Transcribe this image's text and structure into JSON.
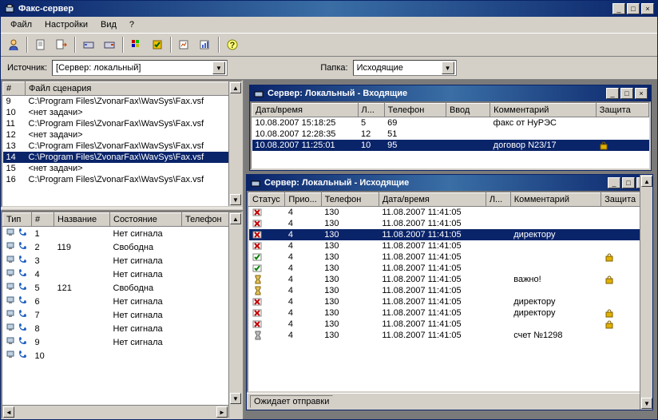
{
  "window": {
    "title": "Факс-сервер"
  },
  "menu": {
    "file": "Файл",
    "settings": "Настройки",
    "view": "Вид",
    "help": "?"
  },
  "filter": {
    "source_label": "Источник:",
    "source_value": "[Сервер: локальный]",
    "folder_label": "Папка:",
    "folder_value": "Исходящие"
  },
  "scenarios": {
    "cols": {
      "num": "#",
      "file": "Файл сценария"
    },
    "rows": [
      {
        "num": "9",
        "file": "C:\\Program Files\\ZvonarFax\\WavSys\\Fax.vsf"
      },
      {
        "num": "10",
        "file": "<нет задачи>"
      },
      {
        "num": "11",
        "file": "C:\\Program Files\\ZvonarFax\\WavSys\\Fax.vsf"
      },
      {
        "num": "12",
        "file": "<нет задачи>"
      },
      {
        "num": "13",
        "file": "C:\\Program Files\\ZvonarFax\\WavSys\\Fax.vsf"
      },
      {
        "num": "14",
        "file": "C:\\Program Files\\ZvonarFax\\WavSys\\Fax.vsf",
        "selected": true
      },
      {
        "num": "15",
        "file": "<нет задачи>"
      },
      {
        "num": "16",
        "file": "C:\\Program Files\\ZvonarFax\\WavSys\\Fax.vsf"
      }
    ]
  },
  "lines": {
    "cols": {
      "type": "Тип",
      "num": "#",
      "name": "Название",
      "state": "Состояние",
      "phone": "Телефон"
    },
    "rows": [
      {
        "num": "1",
        "name": "",
        "state": "Нет сигнала"
      },
      {
        "num": "2",
        "name": "119",
        "state": "Свободна"
      },
      {
        "num": "3",
        "name": "",
        "state": "Нет сигнала"
      },
      {
        "num": "4",
        "name": "",
        "state": "Нет сигнала"
      },
      {
        "num": "5",
        "name": "121",
        "state": "Свободна"
      },
      {
        "num": "6",
        "name": "",
        "state": "Нет сигнала"
      },
      {
        "num": "7",
        "name": "",
        "state": "Нет сигнала"
      },
      {
        "num": "8",
        "name": "",
        "state": "Нет сигнала"
      },
      {
        "num": "9",
        "name": "",
        "state": "Нет сигнала"
      },
      {
        "num": "10",
        "name": "",
        "state": ""
      }
    ]
  },
  "incoming": {
    "title": "Сервер: Локальный - Входящие",
    "cols": {
      "datetime": "Дата/время",
      "l": "Л...",
      "phone": "Телефон",
      "input": "Ввод",
      "comment": "Комментарий",
      "protect": "Защита"
    },
    "rows": [
      {
        "datetime": "10.08.2007 15:18:25",
        "l": "5",
        "phone": "69",
        "input": "",
        "comment": "факс от НуРЭС",
        "protect": ""
      },
      {
        "datetime": "10.08.2007 12:28:35",
        "l": "12",
        "phone": "51",
        "input": "",
        "comment": "",
        "protect": ""
      },
      {
        "datetime": "10.08.2007 11:25:01",
        "l": "10",
        "phone": "95",
        "input": "",
        "comment": "договор N23/17",
        "protect": "lock",
        "selected": true
      }
    ]
  },
  "outgoing": {
    "title": "Сервер: Локальный - Исходящие",
    "cols": {
      "status": "Статус",
      "prio": "Прио...",
      "phone": "Телефон",
      "datetime": "Дата/время",
      "l": "Л...",
      "comment": "Комментарий",
      "protect": "Защита"
    },
    "status_text": "Ожидает отправки",
    "rows": [
      {
        "icon": "fail",
        "prio": "4",
        "phone": "130",
        "datetime": "11.08.2007 11:41:05",
        "l": "",
        "comment": "",
        "protect": ""
      },
      {
        "icon": "fail",
        "prio": "4",
        "phone": "130",
        "datetime": "11.08.2007 11:41:05",
        "l": "",
        "comment": "",
        "protect": ""
      },
      {
        "icon": "fail",
        "prio": "4",
        "phone": "130",
        "datetime": "11.08.2007 11:41:05",
        "l": "",
        "comment": "директору",
        "protect": "",
        "selected": true
      },
      {
        "icon": "fail",
        "prio": "4",
        "phone": "130",
        "datetime": "11.08.2007 11:41:05",
        "l": "",
        "comment": "",
        "protect": ""
      },
      {
        "icon": "ok",
        "prio": "4",
        "phone": "130",
        "datetime": "11.08.2007 11:41:05",
        "l": "",
        "comment": "",
        "protect": "lock"
      },
      {
        "icon": "ok",
        "prio": "4",
        "phone": "130",
        "datetime": "11.08.2007 11:41:05",
        "l": "",
        "comment": "",
        "protect": ""
      },
      {
        "icon": "wait",
        "prio": "4",
        "phone": "130",
        "datetime": "11.08.2007 11:41:05",
        "l": "",
        "comment": "важно!",
        "protect": "lock"
      },
      {
        "icon": "wait",
        "prio": "4",
        "phone": "130",
        "datetime": "11.08.2007 11:41:05",
        "l": "",
        "comment": "",
        "protect": ""
      },
      {
        "icon": "fail",
        "prio": "4",
        "phone": "130",
        "datetime": "11.08.2007 11:41:05",
        "l": "",
        "comment": "директору",
        "protect": ""
      },
      {
        "icon": "fail",
        "prio": "4",
        "phone": "130",
        "datetime": "11.08.2007 11:41:05",
        "l": "",
        "comment": "директору",
        "protect": "lock"
      },
      {
        "icon": "fail",
        "prio": "4",
        "phone": "130",
        "datetime": "11.08.2007 11:41:05",
        "l": "",
        "comment": "",
        "protect": "lock"
      },
      {
        "icon": "wait2",
        "prio": "4",
        "phone": "130",
        "datetime": "11.08.2007 11:41:05",
        "l": "",
        "comment": "счет №1298",
        "protect": ""
      }
    ]
  }
}
